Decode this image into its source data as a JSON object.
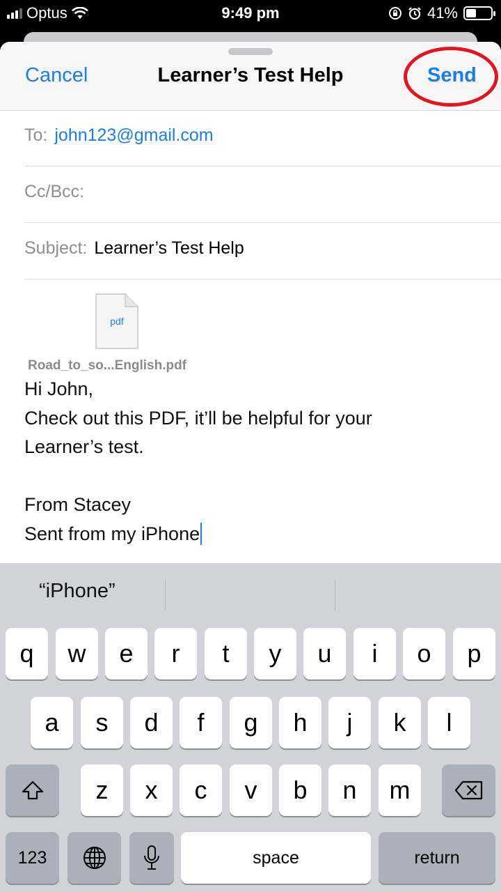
{
  "status_bar": {
    "carrier": "Optus",
    "time": "9:49 pm",
    "battery_percent": "41%",
    "battery_level": 0.41,
    "icons": [
      "signal-icon",
      "wifi-icon",
      "rotation-lock-icon",
      "alarm-icon",
      "battery-icon"
    ]
  },
  "compose": {
    "cancel_label": "Cancel",
    "title": "Learner’s Test Help",
    "send_label": "Send",
    "to_label": "To:",
    "to_value": "john123@gmail.com",
    "cc_label": "Cc/Bcc:",
    "subject_label": "Subject:",
    "subject_value": "Learner’s Test Help",
    "attachment": {
      "icon_text": "pdf",
      "filename": "Road_to_so...English.pdf"
    },
    "body_lines": [
      "Hi John,",
      "Check out this PDF, it’ll be helpful for your",
      "Learner’s test.",
      "",
      "From Stacey",
      "Sent from my iPhone"
    ]
  },
  "keyboard": {
    "suggestions": [
      "“iPhone”",
      "",
      ""
    ],
    "row1": [
      "q",
      "w",
      "e",
      "r",
      "t",
      "y",
      "u",
      "i",
      "o",
      "p"
    ],
    "row2": [
      "a",
      "s",
      "d",
      "f",
      "g",
      "h",
      "j",
      "k",
      "l"
    ],
    "row3": [
      "z",
      "x",
      "c",
      "v",
      "b",
      "n",
      "m"
    ],
    "numbers_label": "123",
    "space_label": "space",
    "return_label": "return"
  },
  "colors": {
    "accent": "#1a7cf0",
    "highlight_circle": "#e3141e"
  }
}
